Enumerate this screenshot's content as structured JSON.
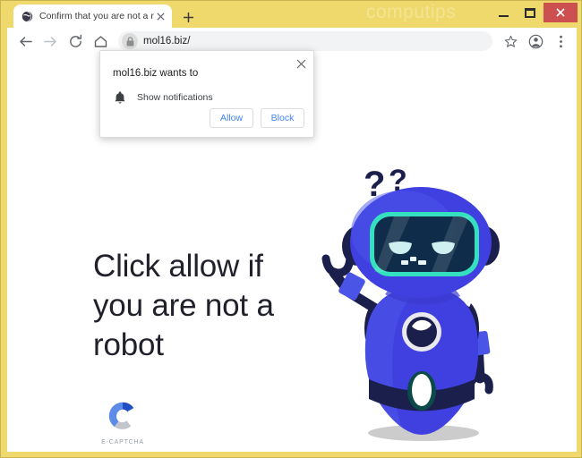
{
  "window": {
    "watermark": "computips",
    "controls": {
      "minimize": "minimize-button",
      "maximize": "maximize-button",
      "close": "close-button"
    }
  },
  "tabs": [
    {
      "title": "Confirm that you are not a robot",
      "favicon": "globe-icon",
      "close_label": "×"
    }
  ],
  "new_tab_label": "+",
  "toolbar": {
    "back": "back-arrow-icon",
    "forward": "forward-arrow-icon",
    "reload": "reload-icon",
    "home": "home-icon",
    "lock": "lock-icon",
    "url": "mol16.biz/",
    "bookmark": "star-icon",
    "profile": "profile-avatar-icon",
    "menu": "three-dot-menu-icon"
  },
  "permission_dialog": {
    "title": "mol16.biz wants to",
    "permission": "Show notifications",
    "permission_icon": "bell-icon",
    "close_label": "×",
    "allow_label": "Allow",
    "block_label": "Block",
    "accent_color": "#4285f4"
  },
  "page": {
    "headline": "Click allow if you are not a robot",
    "captcha": {
      "logo_icon": "e-captcha-logo-icon",
      "label": "E-CAPTCHA"
    },
    "robot": {
      "name": "robot-mascot-illustration",
      "question_marks": "??",
      "body_color": "#4040e0",
      "visor_color": "#0f2d4a",
      "visor_border_color": "#35e0c0",
      "dark_color": "#1b1f4b"
    }
  }
}
